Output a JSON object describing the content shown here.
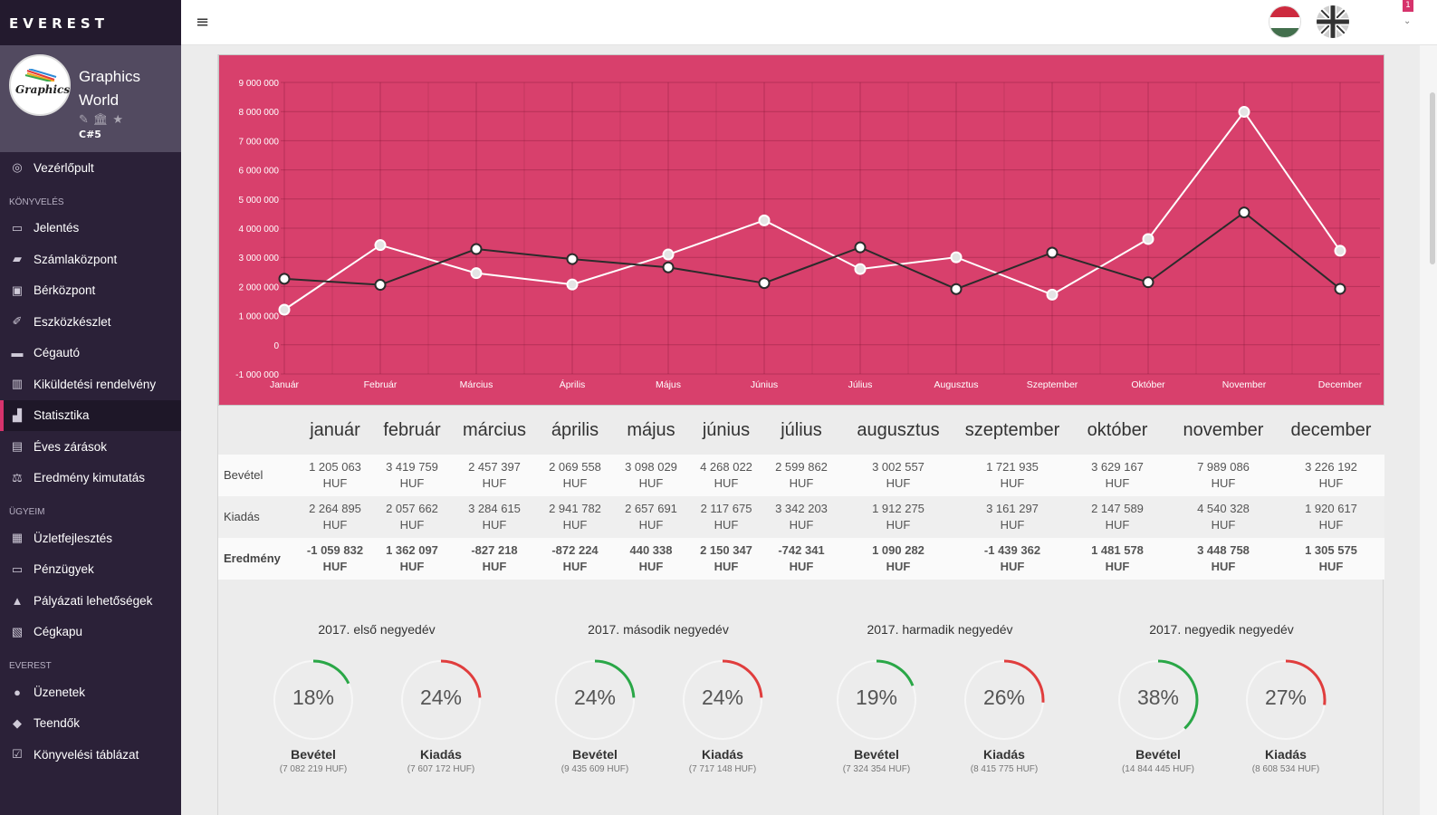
{
  "app": {
    "logo": "EVEREST"
  },
  "profile": {
    "avatar_text": "Graphics",
    "name": "Graphics World",
    "sub": "C#5",
    "icons": [
      "pencil-icon",
      "bank-icon",
      "star-icon"
    ]
  },
  "sidebar": {
    "items": [
      {
        "type": "item",
        "label": "Vezérlőpult",
        "icon": "dashboard-icon"
      },
      {
        "type": "section",
        "label": "KÖNYVELÉS"
      },
      {
        "type": "item",
        "label": "Jelentés",
        "icon": "book-icon"
      },
      {
        "type": "item",
        "label": "Számlaközpont",
        "icon": "folder-icon"
      },
      {
        "type": "item",
        "label": "Bérközpont",
        "icon": "money-icon"
      },
      {
        "type": "item",
        "label": "Eszközkészlet",
        "icon": "brush-icon"
      },
      {
        "type": "item",
        "label": "Cégautó",
        "icon": "car-icon"
      },
      {
        "type": "item",
        "label": "Kiküldetési rendelvény",
        "icon": "map-icon"
      },
      {
        "type": "item",
        "label": "Statisztika",
        "icon": "bar-chart-icon",
        "active": true
      },
      {
        "type": "item",
        "label": "Éves zárások",
        "icon": "briefcase-icon"
      },
      {
        "type": "item",
        "label": "Eredmény kimutatás",
        "icon": "scale-icon"
      },
      {
        "type": "section",
        "label": "ÜGYEIM"
      },
      {
        "type": "item",
        "label": "Üzletfejlesztés",
        "icon": "table-icon"
      },
      {
        "type": "item",
        "label": "Pénzügyek",
        "icon": "banknote-icon"
      },
      {
        "type": "item",
        "label": "Pályázati lehetőségek",
        "icon": "road-icon"
      },
      {
        "type": "item",
        "label": "Cégkapu",
        "icon": "gateway-icon"
      },
      {
        "type": "section",
        "label": "EVEREST"
      },
      {
        "type": "item",
        "label": "Üzenetek",
        "icon": "chat-icon"
      },
      {
        "type": "item",
        "label": "Teendők",
        "icon": "tag-icon"
      },
      {
        "type": "item",
        "label": "Könyvelési táblázat",
        "icon": "checkbox-icon"
      }
    ]
  },
  "topbar": {
    "notification_count": "1"
  },
  "colors": {
    "chart_bg": "#d8406c",
    "income_line": "#ffffff",
    "expense_line": "#2b2b2b",
    "positive": "#2aa747",
    "negative": "#e03d3d",
    "income_gauge": "#2aa747",
    "expense_gauge": "#e03d3d"
  },
  "chart_data": {
    "type": "line",
    "categories": [
      "Január",
      "Február",
      "Március",
      "Április",
      "Május",
      "Június",
      "Július",
      "Augusztus",
      "Szeptember",
      "Október",
      "November",
      "December"
    ],
    "yticks": [
      "9 000 000",
      "8 000 000",
      "7 000 000",
      "6 000 000",
      "5 000 000",
      "4 000 000",
      "3 000 000",
      "2 000 000",
      "1 000 000",
      "0",
      "-1 000 000"
    ],
    "ylim": [
      -1000000,
      9000000
    ],
    "grid": true,
    "series": [
      {
        "values": [
          1205063,
          3419759,
          2457397,
          2069558,
          3098029,
          4268022,
          2599862,
          3002557,
          1721935,
          3629167,
          7989086,
          3226192
        ]
      },
      {
        "values": [
          2264895,
          2057662,
          3284615,
          2941782,
          2657691,
          2117675,
          3342203,
          1912275,
          3161297,
          2147589,
          4540328,
          1920617
        ]
      }
    ]
  },
  "table": {
    "months": [
      "január",
      "február",
      "március",
      "április",
      "május",
      "június",
      "július",
      "augusztus",
      "szeptember",
      "október",
      "november",
      "december"
    ],
    "currency": "HUF",
    "income_label": "Bevétel",
    "expense_label": "Kiadás",
    "result_label": "Eredmény",
    "income": [
      "1 205 063",
      "3 419 759",
      "2 457 397",
      "2 069 558",
      "3 098 029",
      "4 268 022",
      "2 599 862",
      "3 002 557",
      "1 721 935",
      "3 629 167",
      "7 989 086",
      "3 226 192"
    ],
    "expense": [
      "2 264 895",
      "2 057 662",
      "3 284 615",
      "2 941 782",
      "2 657 691",
      "2 117 675",
      "3 342 203",
      "1 912 275",
      "3 161 297",
      "2 147 589",
      "4 540 328",
      "1 920 617"
    ],
    "result": [
      "-1 059 832",
      "1 362 097",
      "-827 218",
      "-872 224",
      "440 338",
      "2 150 347",
      "-742 341",
      "1 090 282",
      "-1 439 362",
      "1 481 578",
      "3 448 758",
      "1 305 575"
    ]
  },
  "quarters": [
    {
      "title": "2017. első negyedév",
      "income_pct": 18,
      "expense_pct": 24,
      "income_label": "Bevétel",
      "expense_label": "Kiadás",
      "income_total": "(7 082 219 HUF)",
      "expense_total": "(7 607 172 HUF)"
    },
    {
      "title": "2017. második negyedév",
      "income_pct": 24,
      "expense_pct": 24,
      "income_label": "Bevétel",
      "expense_label": "Kiadás",
      "income_total": "(9 435 609 HUF)",
      "expense_total": "(7 717 148 HUF)"
    },
    {
      "title": "2017. harmadik negyedév",
      "income_pct": 19,
      "expense_pct": 26,
      "income_label": "Bevétel",
      "expense_label": "Kiadás",
      "income_total": "(7 324 354 HUF)",
      "expense_total": "(8 415 775 HUF)"
    },
    {
      "title": "2017. negyedik negyedév",
      "income_pct": 38,
      "expense_pct": 27,
      "income_label": "Bevétel",
      "expense_label": "Kiadás",
      "income_total": "(14 844 445 HUF)",
      "expense_total": "(8 608 534 HUF)"
    }
  ]
}
